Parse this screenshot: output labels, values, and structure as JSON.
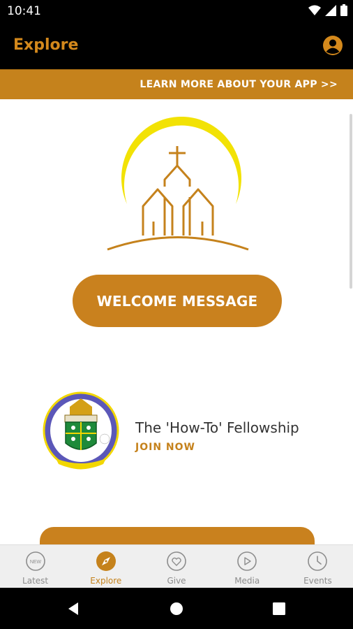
{
  "status": {
    "time": "10:41"
  },
  "app_bar": {
    "title": "Explore"
  },
  "banner": {
    "text": "LEARN MORE ABOUT YOUR APP >>"
  },
  "main": {
    "welcome_button": "WELCOME MESSAGE",
    "fellowship": {
      "title": "The 'How-To' Fellowship",
      "action": "JOIN NOW"
    }
  },
  "tabs": [
    {
      "label": "Latest",
      "icon": "new-badge-icon",
      "active": false
    },
    {
      "label": "Explore",
      "icon": "compass-icon",
      "active": true
    },
    {
      "label": "Give",
      "icon": "heart-icon",
      "active": false
    },
    {
      "label": "Media",
      "icon": "play-icon",
      "active": false
    },
    {
      "label": "Events",
      "icon": "clock-icon",
      "active": false
    }
  ],
  "colors": {
    "accent": "#C5821C",
    "halo": "#F2E205",
    "tab_inactive": "#8d8d8d"
  }
}
